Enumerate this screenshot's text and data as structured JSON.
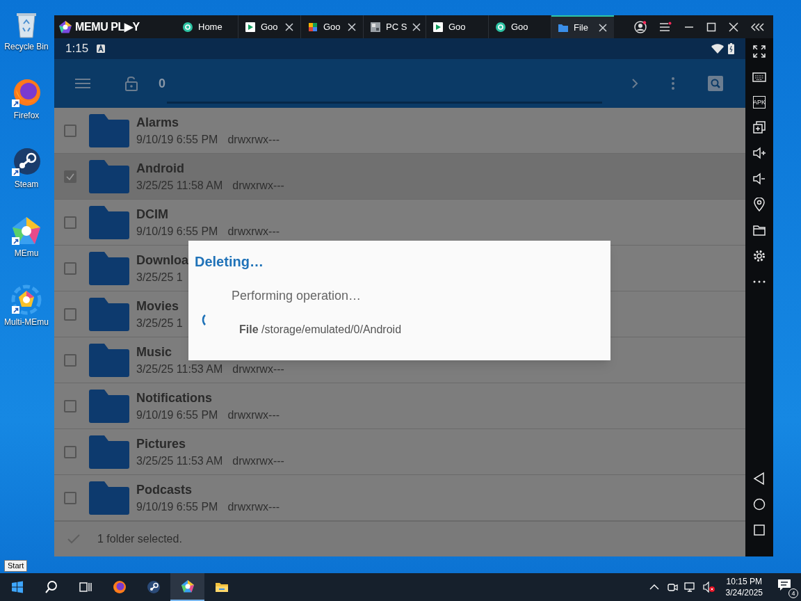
{
  "desktop_icons": [
    {
      "kind": "recycle",
      "label": "Recycle Bin"
    },
    {
      "kind": "firefox",
      "label": "Firefox"
    },
    {
      "kind": "steam",
      "label": "Steam"
    },
    {
      "kind": "memu",
      "label": "MEmu"
    },
    {
      "kind": "multimemu",
      "label": "Multi-MEmu"
    }
  ],
  "window": {
    "logo": "MEMU PL▶Y",
    "tabs": [
      {
        "label": "Home",
        "kind": "teal",
        "closable": false,
        "selected": false
      },
      {
        "label": "Goo",
        "kind": "play",
        "closable": true,
        "selected": false
      },
      {
        "label": "Goo",
        "kind": "puzzle",
        "closable": true,
        "selected": false
      },
      {
        "label": "PC S",
        "kind": "gray",
        "closable": true,
        "selected": false
      },
      {
        "label": "Goo",
        "kind": "play",
        "closable": false,
        "selected": false
      },
      {
        "label": "Goo",
        "kind": "teal",
        "closable": false,
        "selected": false
      },
      {
        "label": "File",
        "kind": "folder",
        "closable": true,
        "selected": true
      }
    ]
  },
  "android": {
    "status_bar": {
      "time": "1:15"
    },
    "toolbar": {
      "count": "0"
    },
    "files": [
      {
        "name": "Alarms",
        "date": "9/10/19 6:55 PM",
        "permissions": "drwxrwx---",
        "checked": false
      },
      {
        "name": "Android",
        "date": "3/25/25 11:58 AM",
        "permissions": "drwxrwx---",
        "checked": true
      },
      {
        "name": "DCIM",
        "date": "9/10/19 6:55 PM",
        "permissions": "drwxrwx---",
        "checked": false
      },
      {
        "name": "Downloa",
        "date": "3/25/25 1",
        "checked": false
      },
      {
        "name": "Movies",
        "date": "3/25/25 1",
        "checked": false
      },
      {
        "name": "Music",
        "date": "3/25/25 11:53 AM",
        "permissions": "drwxrwx---",
        "checked": false
      },
      {
        "name": "Notifications",
        "date": "9/10/19 6:55 PM",
        "permissions": "drwxrwx---",
        "checked": false
      },
      {
        "name": "Pictures",
        "date": "3/25/25 11:53 AM",
        "permissions": "drwxrwx---",
        "checked": false
      },
      {
        "name": "Podcasts",
        "date": "9/10/19 6:55 PM",
        "permissions": "drwxrwx---",
        "checked": false
      }
    ],
    "bottom_bar": {
      "text": "1 folder selected."
    },
    "dialog": {
      "title": "Deleting…",
      "message": "Performing operation…",
      "detail": "**File** /storage/emulated/0/Android"
    }
  },
  "sidebar": {
    "tools": [
      {
        "kind": "fullscreen"
      },
      {
        "kind": "keyboard"
      },
      {
        "kind": "apk",
        "label": "APK"
      },
      {
        "kind": "multi"
      },
      {
        "kind": "volup"
      },
      {
        "kind": "voldown"
      },
      {
        "kind": "location"
      },
      {
        "kind": "folder"
      },
      {
        "kind": "settings"
      },
      {
        "kind": "more"
      }
    ],
    "nav": [
      {
        "kind": "back"
      },
      {
        "kind": "home"
      },
      {
        "kind": "recents"
      }
    ]
  },
  "tooltip": "Start",
  "taskbar": {
    "apps": [
      {
        "kind": "start",
        "selected": false
      },
      {
        "kind": "search",
        "selected": false
      },
      {
        "kind": "taskview",
        "selected": false
      },
      {
        "kind": "firefox",
        "selected": false
      },
      {
        "kind": "steam",
        "selected": false
      },
      {
        "kind": "memu",
        "selected": true
      },
      {
        "kind": "explorer",
        "selected": false
      }
    ],
    "time": "10:15 PM",
    "date": "3/24/2025",
    "notifications": "4"
  }
}
